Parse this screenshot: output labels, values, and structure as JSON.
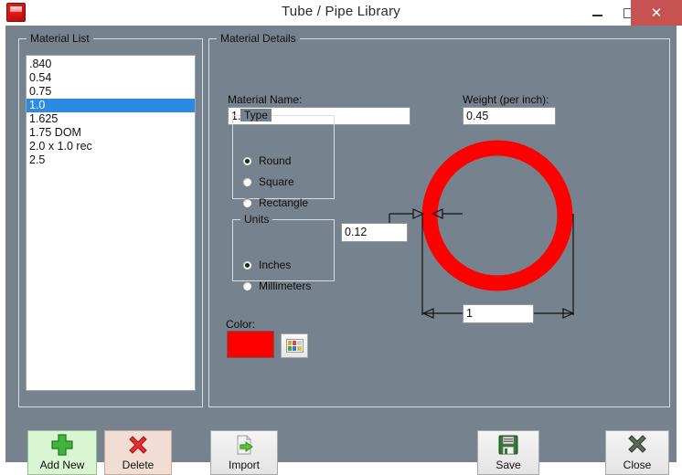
{
  "window": {
    "title": "Tube / Pipe  Library",
    "app_icon": "red-document-icon",
    "minimize_label": "–",
    "maximize_label": "□",
    "close_label": "✕"
  },
  "material_list": {
    "legend": "Material List",
    "items": [
      {
        "label": ".840",
        "selected": false
      },
      {
        "label": "0.54",
        "selected": false
      },
      {
        "label": "0.75",
        "selected": false
      },
      {
        "label": "1.0",
        "selected": true
      },
      {
        "label": "1.625",
        "selected": false
      },
      {
        "label": "1.75 DOM",
        "selected": false
      },
      {
        "label": "2.0 x 1.0 rec",
        "selected": false
      },
      {
        "label": "2.5",
        "selected": false
      }
    ]
  },
  "details": {
    "legend": "Material Details",
    "material_name": {
      "label": "Material Name:",
      "value": "1.0"
    },
    "weight": {
      "label": "Weight (per inch):",
      "value": "0.45"
    },
    "type": {
      "legend": "Type",
      "options": [
        {
          "label": "Round",
          "selected": true
        },
        {
          "label": "Square",
          "selected": false
        },
        {
          "label": "Rectangle",
          "selected": false
        }
      ]
    },
    "units": {
      "legend": "Units",
      "options": [
        {
          "label": "Inches",
          "selected": true
        },
        {
          "label": "Millimeters",
          "selected": false
        }
      ]
    },
    "color": {
      "label": "Color:",
      "value": "#fe0000",
      "picker_icon": "color-palette-icon",
      "palette_swatches": [
        "#f0a030",
        "#d84a4a",
        "#cfcfcf",
        "#3fa33f",
        "#3f6fd0",
        "#d8c23f"
      ]
    },
    "diagram": {
      "shape": "round-tube-cross-section",
      "shape_color": "#fe0000",
      "wall_thickness": "0.12",
      "diameter": "1"
    }
  },
  "buttons": [
    {
      "label": "Add New",
      "icon": "green-plus-icon"
    },
    {
      "label": "Delete",
      "icon": "red-x-icon"
    },
    {
      "label": "Import",
      "icon": "import-document-icon"
    },
    {
      "label": "Save",
      "icon": "floppy-disk-icon"
    },
    {
      "label": "Close",
      "icon": "gray-x-icon"
    }
  ]
}
